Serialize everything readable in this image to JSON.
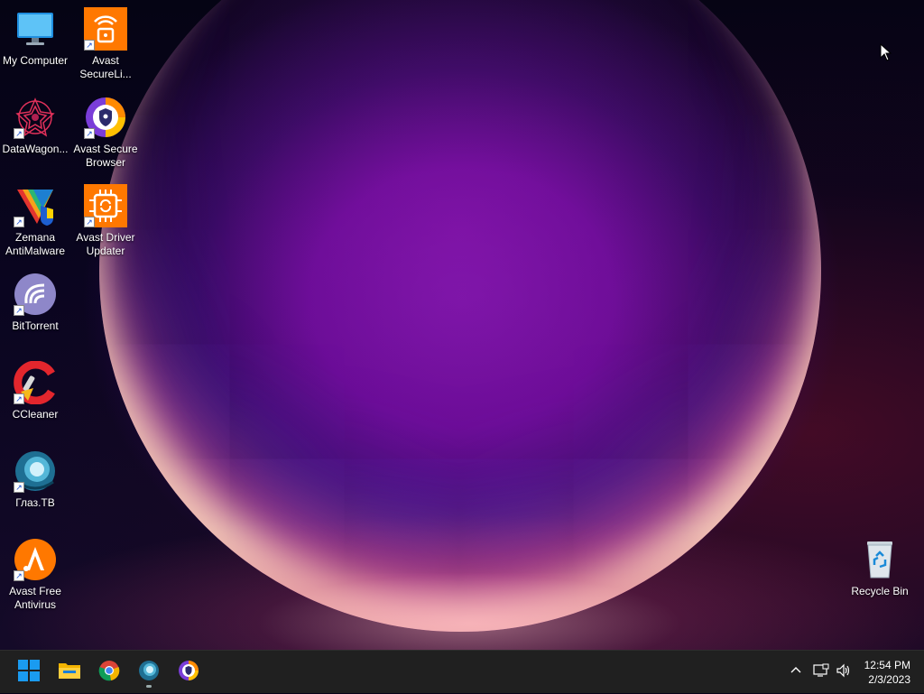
{
  "desktop": {
    "icons": [
      {
        "label": "My Computer",
        "icon": "monitor-icon"
      },
      {
        "label": "Avast SecureLi...",
        "icon": "avast-secureline-icon"
      },
      {
        "label": "DataWagon...",
        "icon": "datawagon-icon"
      },
      {
        "label": "Avast Secure Browser",
        "icon": "avast-secure-browser-icon"
      },
      {
        "label": "Zemana AntiMalware",
        "icon": "zemana-icon"
      },
      {
        "label": "Avast Driver Updater",
        "icon": "avast-driver-updater-icon"
      },
      {
        "label": "BitTorrent",
        "icon": "bittorrent-icon"
      },
      {
        "label": "CCleaner",
        "icon": "ccleaner-icon"
      },
      {
        "label": "Глаз.ТВ",
        "icon": "glaz-tv-icon"
      },
      {
        "label": "Avast Free Antivirus",
        "icon": "avast-antivirus-icon"
      },
      {
        "label": "Recycle Bin",
        "icon": "recycle-bin-icon"
      }
    ]
  },
  "taskbar": {
    "pinned": [
      "start-icon",
      "file-explorer-icon",
      "chrome-icon",
      "glaz-tv-icon",
      "avast-secure-browser-icon"
    ],
    "tray": [
      "chevron-up-icon",
      "network-icon",
      "volume-icon"
    ],
    "time": "12:54 PM",
    "date": "2/3/2023"
  },
  "colors": {
    "taskbar_bg": "#202020",
    "avast_orange": "#ff7800",
    "windows_blue": "#1a9bf0"
  }
}
